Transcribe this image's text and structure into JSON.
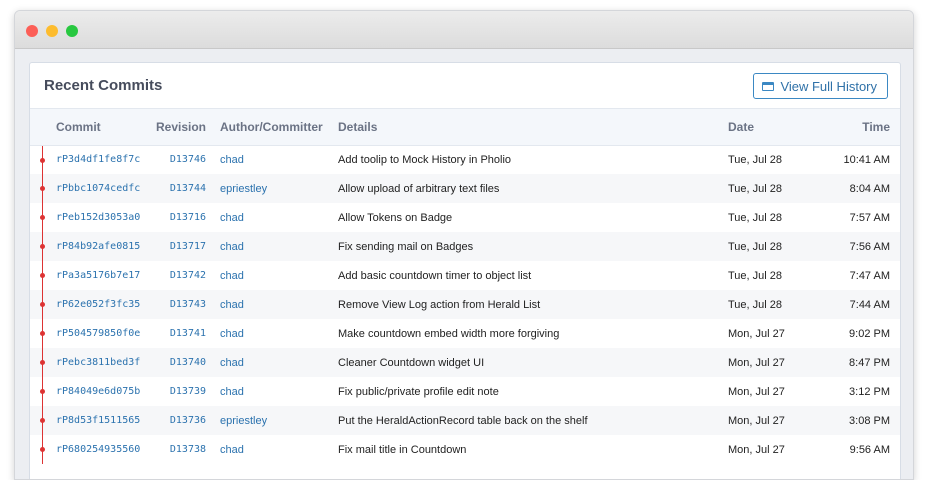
{
  "window": {
    "controls": [
      "close",
      "minimize",
      "maximize"
    ]
  },
  "panel": {
    "title": "Recent Commits",
    "view_history_label": "View Full History"
  },
  "columns": {
    "commit": "Commit",
    "revision": "Revision",
    "author": "Author/Committer",
    "details": "Details",
    "date": "Date",
    "time": "Time"
  },
  "commits": [
    {
      "commit": "rP3d4df1fe8f7c",
      "revision": "D13746",
      "author": "chad",
      "details": "Add toolip to Mock History in Pholio",
      "date": "Tue, Jul 28",
      "time": "10:41 AM"
    },
    {
      "commit": "rPbbc1074cedfc",
      "revision": "D13744",
      "author": "epriestley",
      "details": "Allow upload of arbitrary text files",
      "date": "Tue, Jul 28",
      "time": "8:04 AM"
    },
    {
      "commit": "rPeb152d3053a0",
      "revision": "D13716",
      "author": "chad",
      "details": "Allow Tokens on Badge",
      "date": "Tue, Jul 28",
      "time": "7:57 AM"
    },
    {
      "commit": "rP84b92afe0815",
      "revision": "D13717",
      "author": "chad",
      "details": "Fix sending mail on Badges",
      "date": "Tue, Jul 28",
      "time": "7:56 AM"
    },
    {
      "commit": "rPa3a5176b7e17",
      "revision": "D13742",
      "author": "chad",
      "details": "Add basic countdown timer to object list",
      "date": "Tue, Jul 28",
      "time": "7:47 AM"
    },
    {
      "commit": "rP62e052f3fc35",
      "revision": "D13743",
      "author": "chad",
      "details": "Remove View Log action from Herald List",
      "date": "Tue, Jul 28",
      "time": "7:44 AM"
    },
    {
      "commit": "rP504579850f0e",
      "revision": "D13741",
      "author": "chad",
      "details": "Make countdown embed width more forgiving",
      "date": "Mon, Jul 27",
      "time": "9:02 PM"
    },
    {
      "commit": "rPebc3811bed3f",
      "revision": "D13740",
      "author": "chad",
      "details": "Cleaner Countdown widget UI",
      "date": "Mon, Jul 27",
      "time": "8:47 PM"
    },
    {
      "commit": "rP84049e6d075b",
      "revision": "D13739",
      "author": "chad",
      "details": "Fix public/private profile edit note",
      "date": "Mon, Jul 27",
      "time": "3:12 PM"
    },
    {
      "commit": "rP8d53f1511565",
      "revision": "D13736",
      "author": "epriestley",
      "details": "Put the HeraldActionRecord table back on the shelf",
      "date": "Mon, Jul 27",
      "time": "3:08 PM"
    },
    {
      "commit": "rP680254935560",
      "revision": "D13738",
      "author": "chad",
      "details": "Fix mail title in Countdown",
      "date": "Mon, Jul 27",
      "time": "9:56 AM"
    }
  ]
}
